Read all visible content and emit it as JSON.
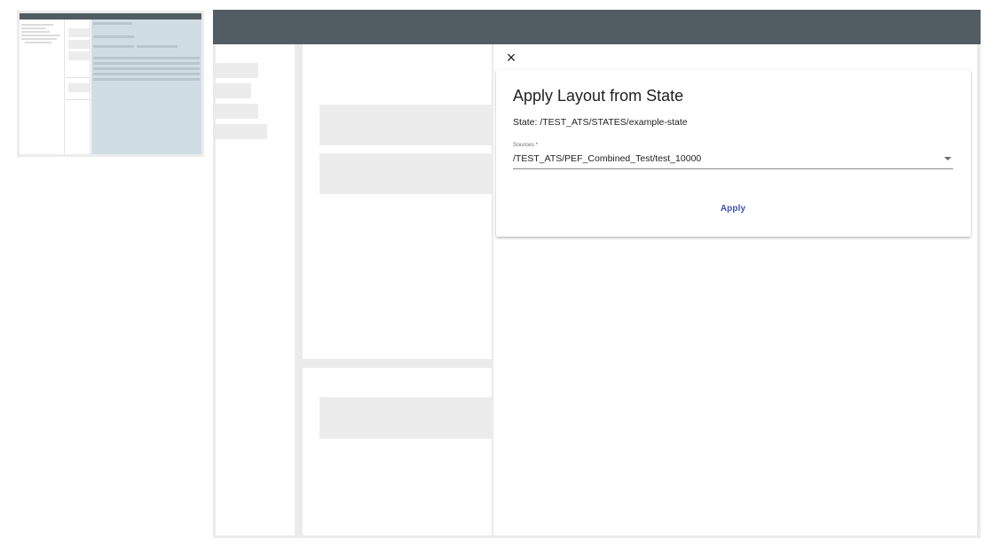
{
  "dialog": {
    "close_icon": "×",
    "title": "Apply Layout from State",
    "state_text": "State: /TEST_ATS/STATES/example-state",
    "sources_label": "Sources *",
    "sources_value": "/TEST_ATS/PEF_Combined_Test/test_10000",
    "apply_label": "Apply"
  },
  "colors": {
    "topbar": "#525c63",
    "accent": "#3f51b5",
    "thumbnail_highlight": "#d1dde5"
  },
  "icons": {
    "close": "close-icon",
    "dropdown": "chevron-down-icon"
  }
}
